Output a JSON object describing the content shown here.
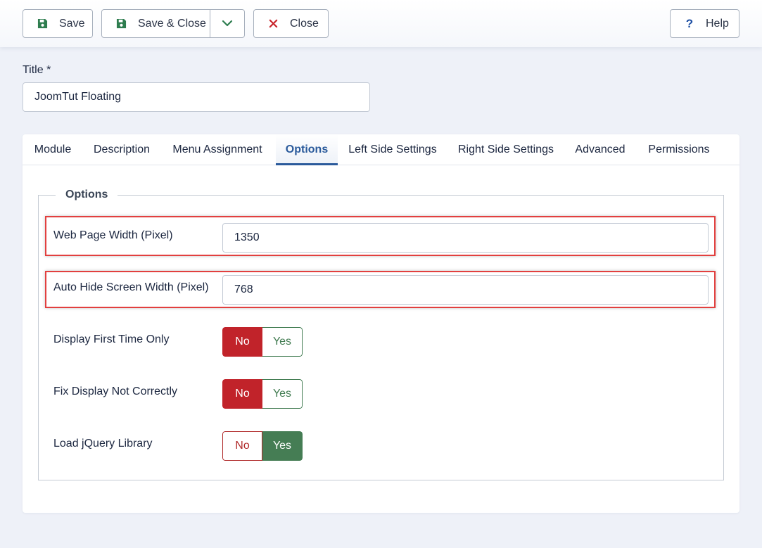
{
  "toolbar": {
    "save_label": "Save",
    "save_close_label": "Save & Close",
    "close_label": "Close",
    "help_label": "Help",
    "help_glyph": "?"
  },
  "title": {
    "label": "Title *",
    "value": "JoomTut Floating"
  },
  "tabs": [
    {
      "label": "Module"
    },
    {
      "label": "Description"
    },
    {
      "label": "Menu Assignment"
    },
    {
      "label": "Options"
    },
    {
      "label": "Left Side Settings"
    },
    {
      "label": "Right Side Settings"
    },
    {
      "label": "Advanced"
    },
    {
      "label": "Permissions"
    }
  ],
  "active_tab": "Options",
  "options": {
    "legend": "Options",
    "web_page_width": {
      "label": "Web Page Width (Pixel)",
      "value": "1350"
    },
    "auto_hide_width": {
      "label": "Auto Hide Screen Width (Pixel)",
      "value": "768"
    },
    "display_first_time": {
      "label": "Display First Time Only",
      "no": "No",
      "yes": "Yes",
      "selected": "No"
    },
    "fix_display": {
      "label": "Fix Display Not Correctly",
      "no": "No",
      "yes": "Yes",
      "selected": "No"
    },
    "load_jquery": {
      "label": "Load jQuery Library",
      "no": "No",
      "yes": "Yes",
      "selected": "Yes"
    }
  },
  "colors": {
    "save_icon": "#2e7d4f",
    "close_icon": "#c8242b",
    "help_icon": "#1d4fa3",
    "active_tab": "#2a5a9b",
    "no_active": "#c1232a",
    "yes_active": "#457d54",
    "highlight": "#e2403f"
  },
  "icons": {
    "save": "floppy-disk-icon",
    "save_close": "floppy-disk-icon",
    "dropdown": "chevron-down-icon",
    "close": "x-icon",
    "help": "question-mark-icon"
  }
}
